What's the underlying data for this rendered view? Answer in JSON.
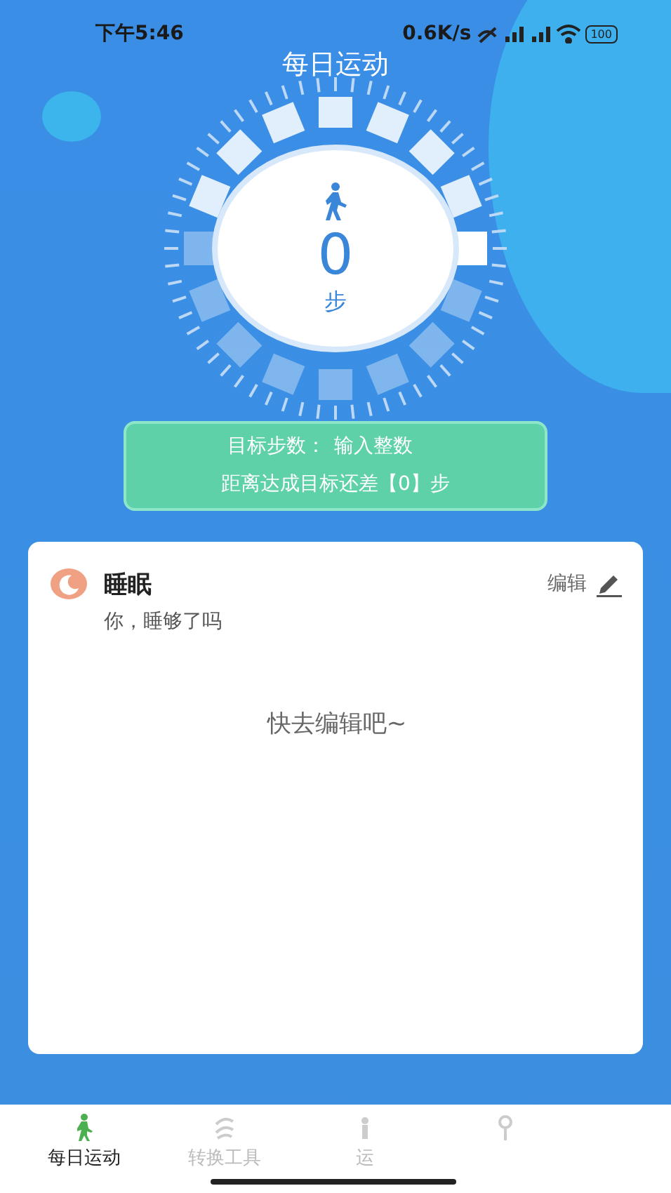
{
  "status_bar": {
    "time": "下午5:46",
    "speed": "0.6K/s",
    "battery": "100"
  },
  "title": "每日运动",
  "steps": {
    "count": "0",
    "unit": "步"
  },
  "goal": {
    "label": "目标步数：",
    "placeholder": "输入整数",
    "remaining": "距离达成目标还差【0】步"
  },
  "card": {
    "title": "睡眠",
    "edit": "编辑",
    "subtitle": "你，睡够了吗",
    "empty": "快去编辑吧~"
  },
  "tabs": [
    {
      "label": "每日运动",
      "kind": "walk",
      "selected": true
    },
    {
      "label": "转换工具",
      "kind": "swirl",
      "selected": false
    },
    {
      "label": "运",
      "kind": "person",
      "selected": false
    },
    {
      "kind": "pin",
      "selected": false
    }
  ]
}
